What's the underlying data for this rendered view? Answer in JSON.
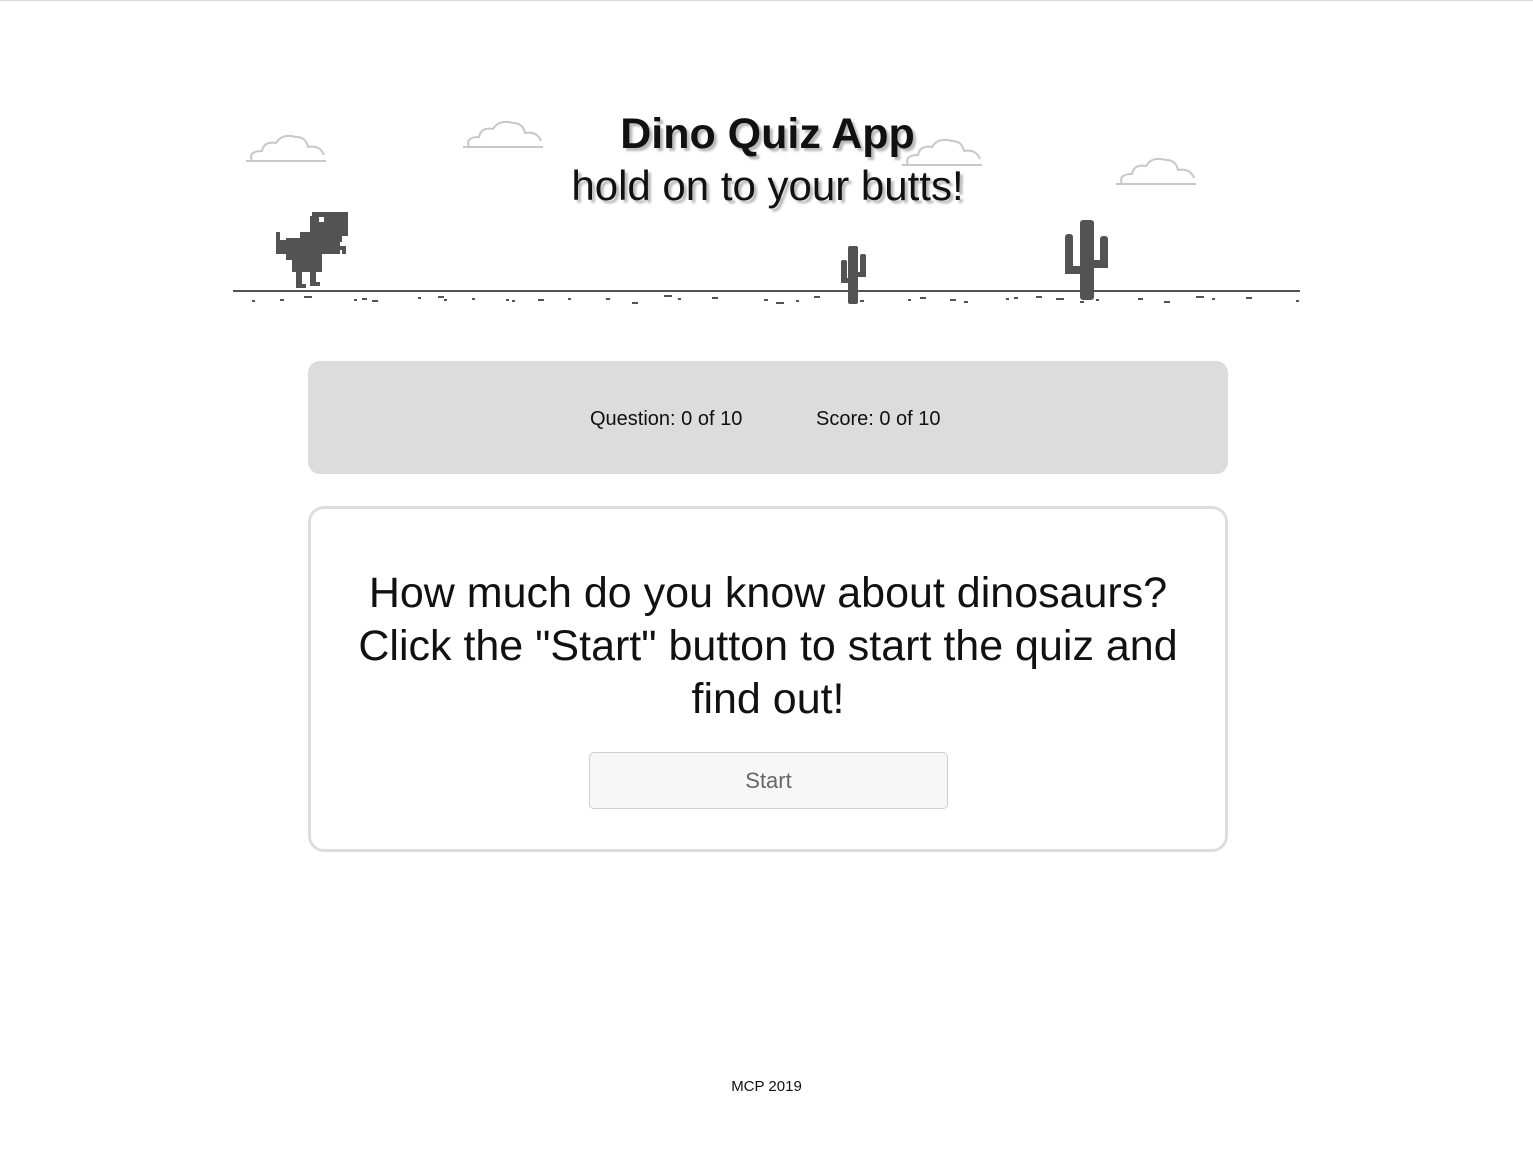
{
  "header": {
    "title": "Dino Quiz App",
    "subtitle": "hold on to your butts!"
  },
  "status": {
    "question": "Question: 0 of 10",
    "score": "Score: 0 of 10"
  },
  "quiz": {
    "intro": "How much do you know about dinosaurs? Click the \"Start\" button to start the quiz and find out!",
    "start_label": "Start"
  },
  "footer": {
    "text": "MCP 2019"
  },
  "colors": {
    "status_bg": "#dcdcdc",
    "card_border": "#dedede",
    "pixel_art": "#535353",
    "cloud": "#c8c8c8"
  }
}
